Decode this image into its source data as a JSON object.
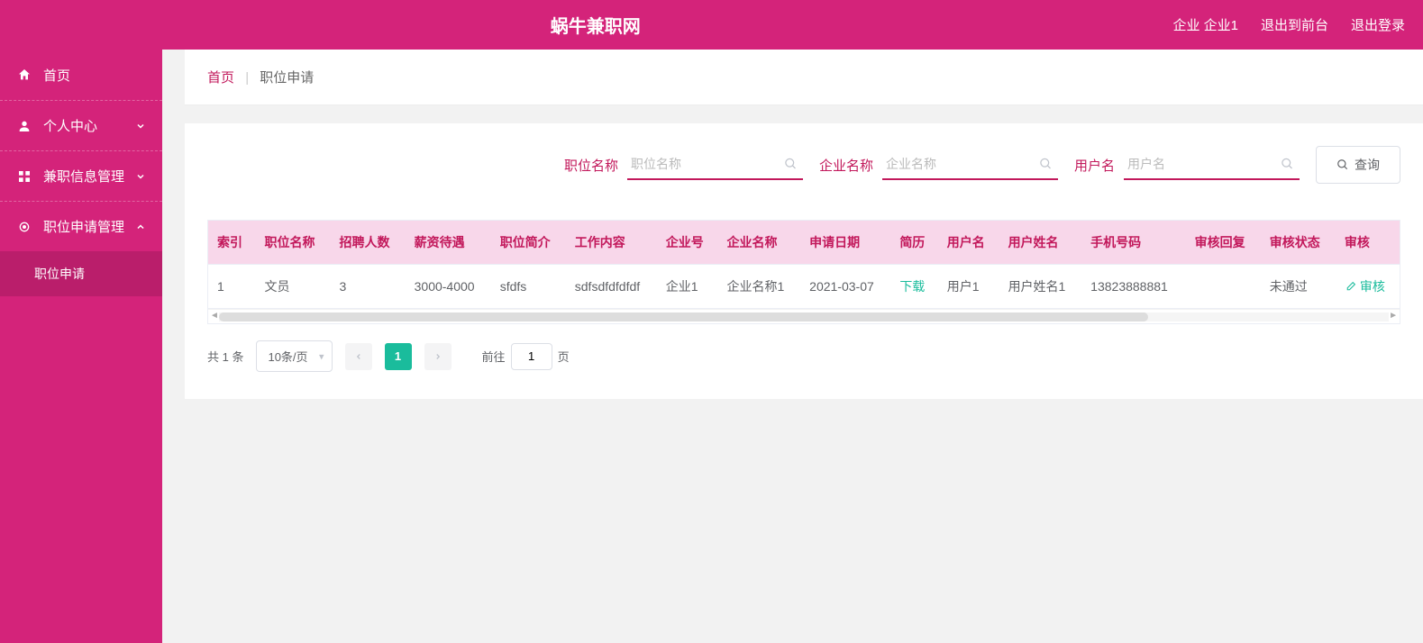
{
  "header": {
    "title": "蜗牛兼职网",
    "user_label": "企业 企业1",
    "logout_front": "退出到前台",
    "logout": "退出登录"
  },
  "sidebar": {
    "items": [
      {
        "label": "首页",
        "icon": "home",
        "expandable": false
      },
      {
        "label": "个人中心",
        "icon": "user",
        "expandable": true,
        "open": false
      },
      {
        "label": "兼职信息管理",
        "icon": "grid",
        "expandable": true,
        "open": false
      },
      {
        "label": "职位申请管理",
        "icon": "gear",
        "expandable": true,
        "open": true,
        "children": [
          {
            "label": "职位申请"
          }
        ]
      }
    ]
  },
  "breadcrumb": {
    "home": "首页",
    "current": "职位申请"
  },
  "search": {
    "groups": [
      {
        "label": "职位名称",
        "placeholder": "职位名称"
      },
      {
        "label": "企业名称",
        "placeholder": "企业名称"
      },
      {
        "label": "用户名",
        "placeholder": "用户名"
      }
    ],
    "query_btn": "查询"
  },
  "table": {
    "columns": [
      "索引",
      "职位名称",
      "招聘人数",
      "薪资待遇",
      "职位简介",
      "工作内容",
      "企业号",
      "企业名称",
      "申请日期",
      "简历",
      "用户名",
      "用户姓名",
      "手机号码",
      "审核回复",
      "审核状态",
      "审核"
    ],
    "rows": [
      {
        "index": "1",
        "position_name": "文员",
        "headcount": "3",
        "salary": "3000-4000",
        "intro": "sfdfs",
        "content": "sdfsdfdfdfdf",
        "company_no": "企业1",
        "company_name": "企业名称1",
        "apply_date": "2021-03-07",
        "resume_action": "下载",
        "username": "用户1",
        "user_realname": "用户姓名1",
        "phone": "13823888881",
        "review_reply": "",
        "review_status": "未通过",
        "review_action": "审核"
      }
    ]
  },
  "pagination": {
    "total_text": "共 1 条",
    "page_size_text": "10条/页",
    "current_page": "1",
    "jump_prefix": "前往",
    "jump_value": "1",
    "jump_suffix": "页"
  }
}
